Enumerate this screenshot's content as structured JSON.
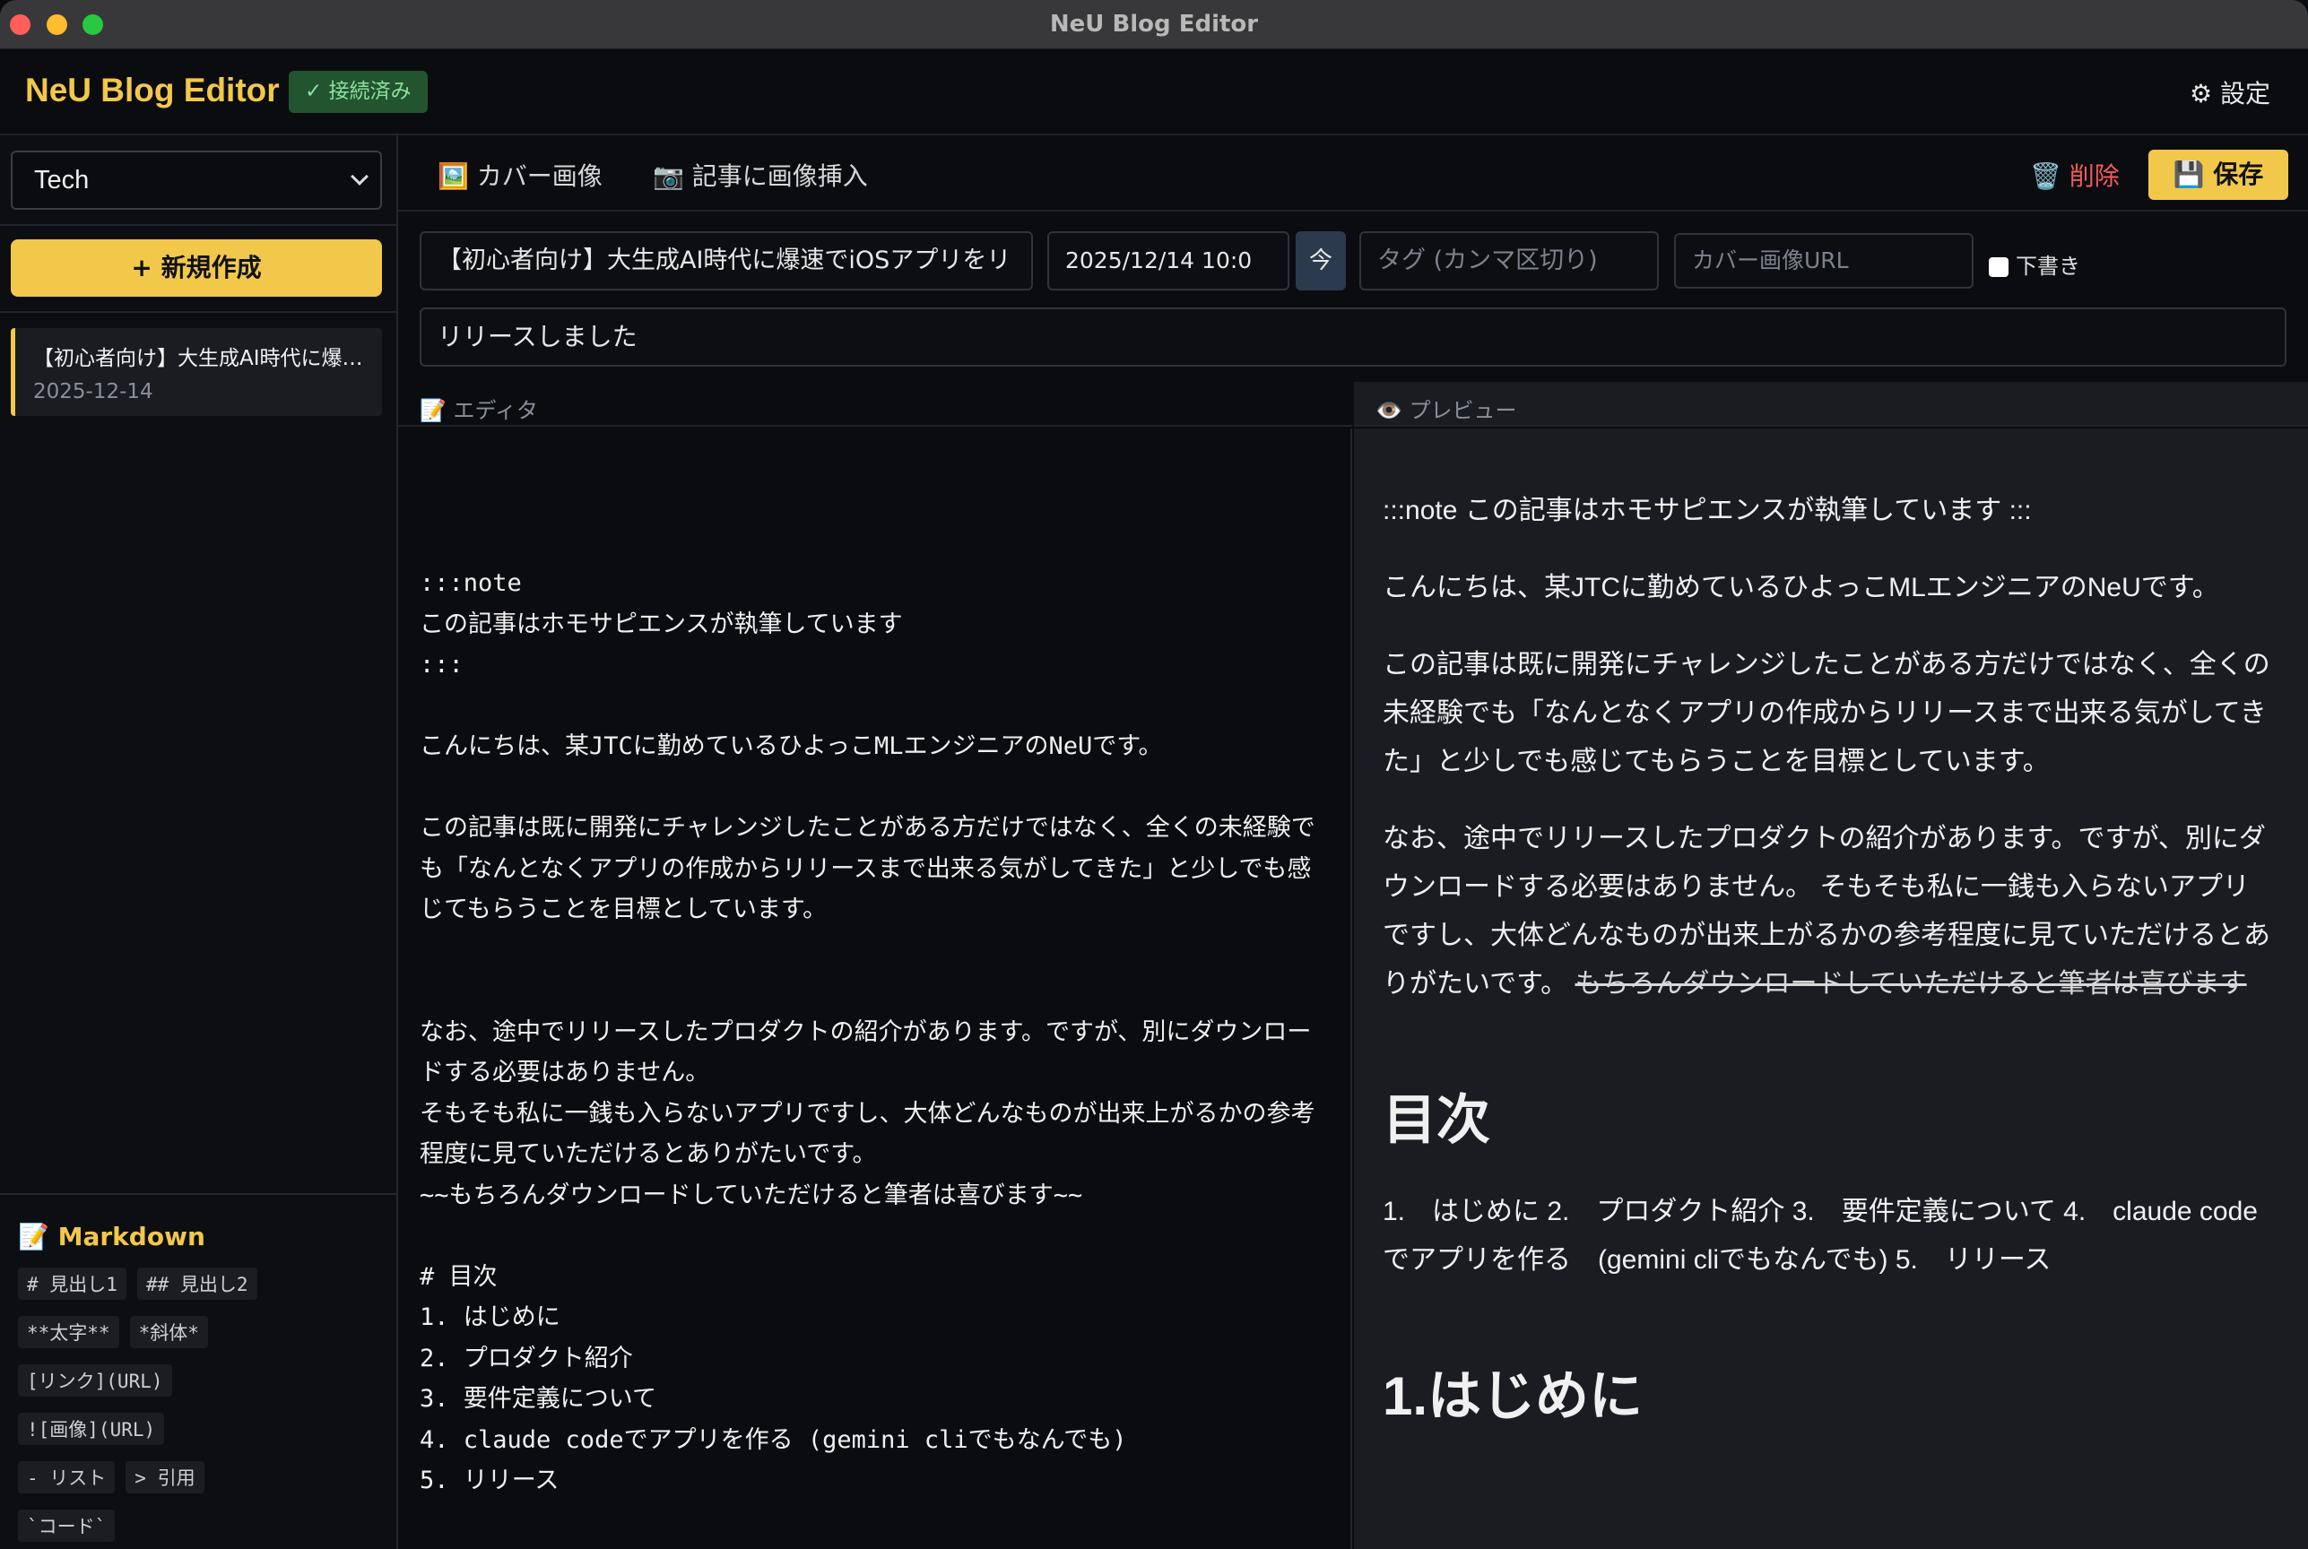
{
  "window": {
    "title": "NeU Blog Editor"
  },
  "header": {
    "brand": "NeU Blog Editor",
    "status": "✓ 接続済み",
    "settings": "⚙ 設定"
  },
  "sidebar": {
    "category": "Tech",
    "new_button": "+ 新規作成",
    "posts": [
      {
        "title": "【初心者向け】大生成AI時代に爆速でiOSアプリをリリースしました",
        "date": "2025-12-14"
      }
    ],
    "markdown": {
      "heading": "📝 Markdown",
      "rows": [
        [
          "# 見出し1",
          "## 見出し2"
        ],
        [
          "**太字**",
          "*斜体*"
        ],
        [
          "[リンク](URL)"
        ],
        [
          "![画像](URL)"
        ],
        [
          "- リスト",
          "> 引用"
        ],
        [
          "`コード`"
        ]
      ]
    }
  },
  "toolbar": {
    "cover": "🖼️ カバー画像",
    "insert": "📷 記事に画像挿入",
    "delete": "🗑️ 削除",
    "save": "💾 保存"
  },
  "fields": {
    "title": "【初心者向け】大生成AI時代に爆速でiOSアプリをリ",
    "date": "2025/12/14 10:0",
    "now": "今",
    "tags_placeholder": "タグ (カンマ区切り)",
    "cover_placeholder": "カバー画像URL",
    "draft": "下書き",
    "subtitle": "リリースしました"
  },
  "panes": {
    "editor": "📝 エディタ",
    "preview": "👁️ プレビュー"
  },
  "editor_text": ":::note\nこの記事はホモサピエンスが執筆しています\n:::\n\nこんにちは、某JTCに勤めているひよっこMLエンジニアのNeUです。\n\nこの記事は既に開発にチャレンジしたことがある方だけではなく、全くの未経験でも「なんとなくアプリの作成からリリースまで出来る気がしてきた」と少しでも感じてもらうことを目標としています。\n\n\nなお、途中でリリースしたプロダクトの紹介があります。ですが、別にダウンロードする必要はありません。\nそもそも私に一銭も入らないアプリですし、大体どんなものが出来上がるかの参考程度に見ていただけるとありがたいです。\n~~もちろんダウンロードしていただけると筆者は喜びます~~\n\n# 目次\n1. はじめに\n2. プロダクト紹介\n3. 要件定義について\n4. claude codeでアプリを作る (gemini cliでもなんでも)\n5. リリース",
  "preview": {
    "p1": ":::note この記事はホモサピエンスが執筆しています :::",
    "p2": "こんにちは、某JTCに勤めているひよっこMLエンジニアのNeUです。",
    "p3": "この記事は既に開発にチャレンジしたことがある方だけではなく、全くの未経験でも「なんとなくアプリの作成からリリースまで出来る気がしてきた」と少しでも感じてもらうことを目標としています。",
    "p4": "なお、途中でリリースしたプロダクトの紹介があります。ですが、別にダウンロードする必要はありません。 そもそも私に一銭も入らないアプリですし、大体どんなものが出来上がるかの参考程度に見ていただけるとありがたいです。",
    "p4_strike": "もちろんダウンロードしていただけると筆者は喜びます",
    "h_toc": "目次",
    "toc": "1.　はじめに 2.　プロダクト紹介 3.　要件定義について 4.　claude codeでアプリを作る　(gemini cliでもなんでも) 5.　リリース",
    "h_intro": "1.はじめに"
  }
}
